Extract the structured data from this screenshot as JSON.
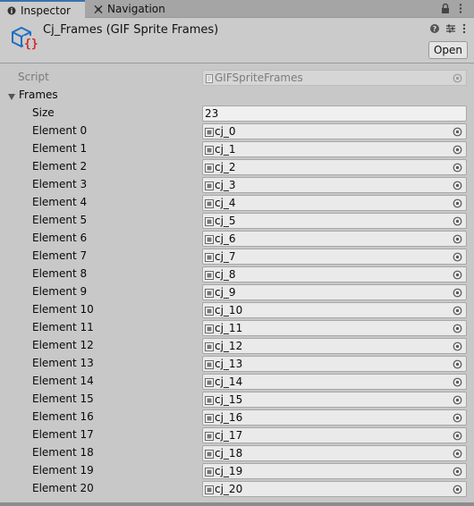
{
  "tabs": {
    "inspector": "Inspector",
    "navigation": "Navigation"
  },
  "header": {
    "title": "Cj_Frames (GIF Sprite Frames)",
    "open_label": "Open"
  },
  "script": {
    "label": "Script",
    "value": "GIFSpriteFrames"
  },
  "frames": {
    "label": "Frames",
    "size_label": "Size",
    "size_value": "23",
    "elements": [
      {
        "label": "Element 0",
        "value": "cj_0"
      },
      {
        "label": "Element 1",
        "value": "cj_1"
      },
      {
        "label": "Element 2",
        "value": "cj_2"
      },
      {
        "label": "Element 3",
        "value": "cj_3"
      },
      {
        "label": "Element 4",
        "value": "cj_4"
      },
      {
        "label": "Element 5",
        "value": "cj_5"
      },
      {
        "label": "Element 6",
        "value": "cj_6"
      },
      {
        "label": "Element 7",
        "value": "cj_7"
      },
      {
        "label": "Element 8",
        "value": "cj_8"
      },
      {
        "label": "Element 9",
        "value": "cj_9"
      },
      {
        "label": "Element 10",
        "value": "cj_10"
      },
      {
        "label": "Element 11",
        "value": "cj_11"
      },
      {
        "label": "Element 12",
        "value": "cj_12"
      },
      {
        "label": "Element 13",
        "value": "cj_13"
      },
      {
        "label": "Element 14",
        "value": "cj_14"
      },
      {
        "label": "Element 15",
        "value": "cj_15"
      },
      {
        "label": "Element 16",
        "value": "cj_16"
      },
      {
        "label": "Element 17",
        "value": "cj_17"
      },
      {
        "label": "Element 18",
        "value": "cj_18"
      },
      {
        "label": "Element 19",
        "value": "cj_19"
      },
      {
        "label": "Element 20",
        "value": "cj_20"
      }
    ]
  },
  "icons": {
    "inspector_tab": "info-icon",
    "navigation_tab": "navigation-icon",
    "lock": "lock-icon",
    "menu": "kebab-menu-icon",
    "help": "help-icon",
    "presets": "presets-icon",
    "object": "scriptable-object-icon",
    "picker": "object-picker-icon",
    "foldout": "foldout-arrow-icon"
  },
  "colors": {
    "active_tab_accent": "#3a72b0",
    "script_icon_blue": "#1f6fc4",
    "script_icon_red": "#d42a2a"
  }
}
